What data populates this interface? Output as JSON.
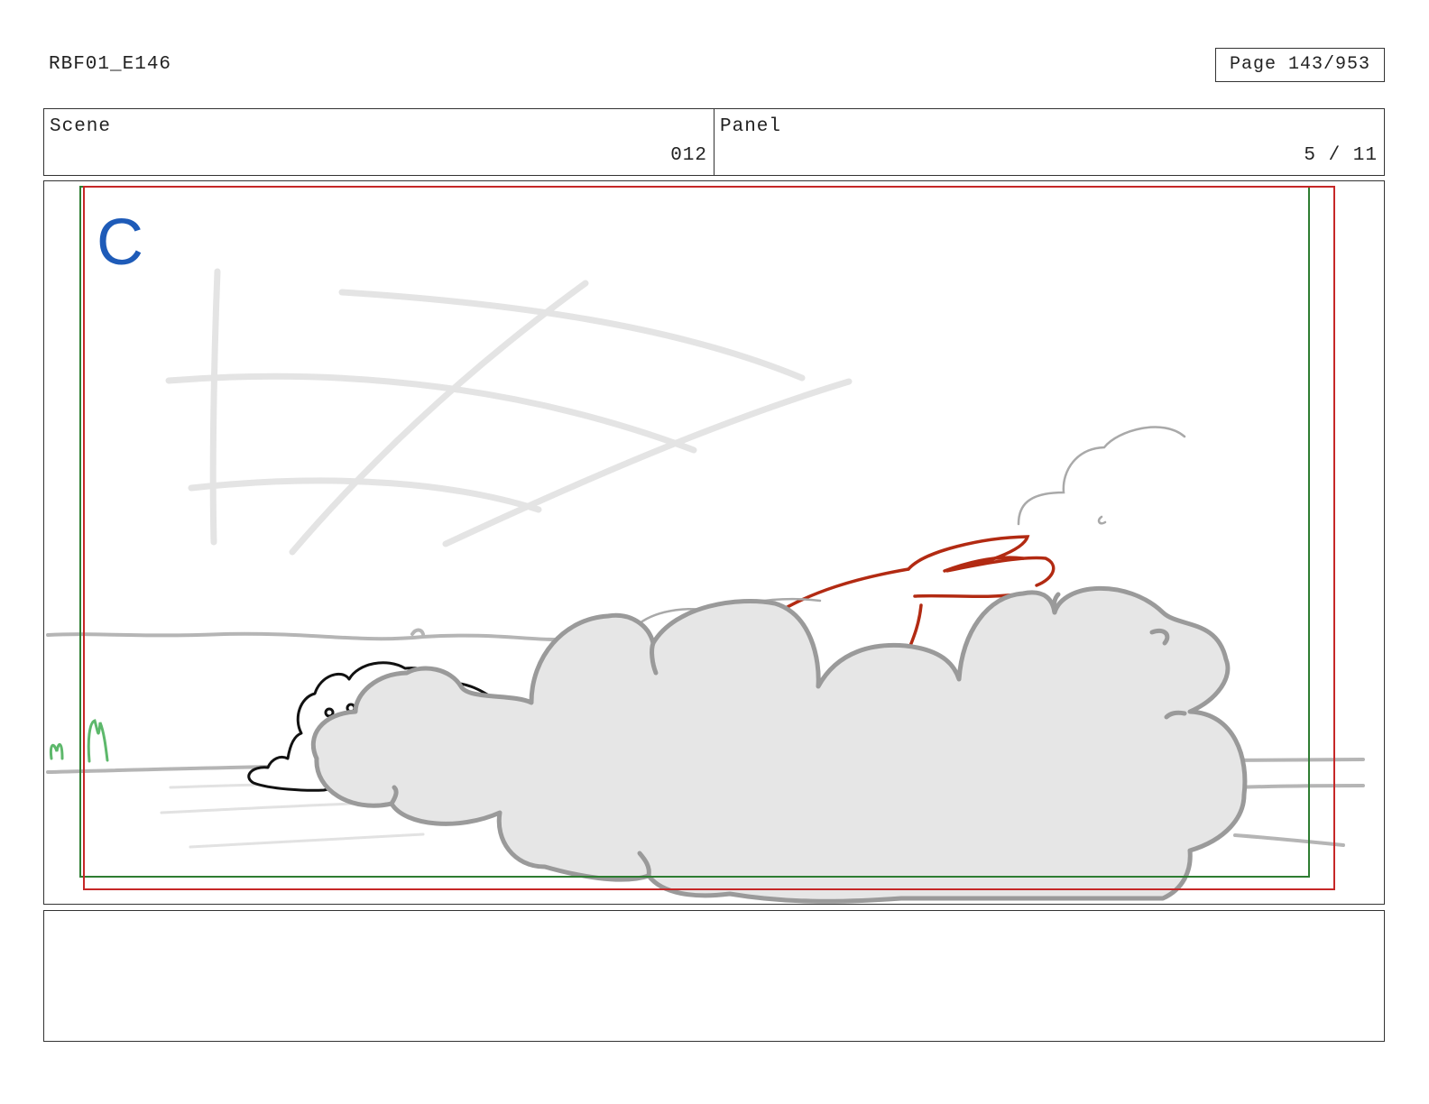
{
  "header": {
    "doc_id": "RBF01_E146",
    "page": "Page 143/953"
  },
  "info": {
    "scene_label": "Scene",
    "scene_value": "012",
    "panel_label": "Panel",
    "panel_value": "5 / 11"
  },
  "panel": {
    "marker": "C",
    "colors": {
      "safe_frame": "#2e7d32",
      "action_frame": "#c62828",
      "marker": "#1e5bb8",
      "dust_fill": "#e6e6e6",
      "dust_outline": "#9a9a9a",
      "character_red": "#b22a12",
      "character_black": "#111111"
    }
  },
  "notes": {
    "text": ""
  }
}
